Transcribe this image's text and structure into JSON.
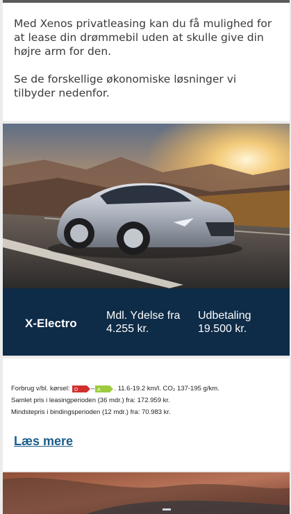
{
  "intro": {
    "paragraph1": "Med Xenos privatleasing kan du få mulighed for at lease din drømmebil uden at skulle give din højre arm for den.",
    "paragraph2": "Se de forskellige økonomiske løsninger vi tilbyder nedenfor."
  },
  "product": {
    "model_name": "X-Electro",
    "monthly_label": "Mdl. Ydelse fra",
    "monthly_value": "4.255 kr.",
    "downpayment_label": "Udbetaling",
    "downpayment_value": "19.500 kr.",
    "banner_color": "#0e2b47"
  },
  "info": {
    "consumption_prefix": "Forbrug v/bl. kørsel:",
    "energy_label_left": "D",
    "energy_label_right": "A",
    "energy_color_left": "#d32f2f",
    "energy_color_right": "#9ccc3c",
    "consumption_suffix": ". 11.6-19.2 km/l. CO₂ 137-195 g/km.",
    "total_price": "Samlet pris i leasingperioden (36 mdr.) fra: 172.959 kr.",
    "min_price": "Mindstepris i bindingsperioden (12 mdr.) fra: 70.983 kr.",
    "read_more": "Læs mere",
    "link_color": "#1b5d8a"
  }
}
